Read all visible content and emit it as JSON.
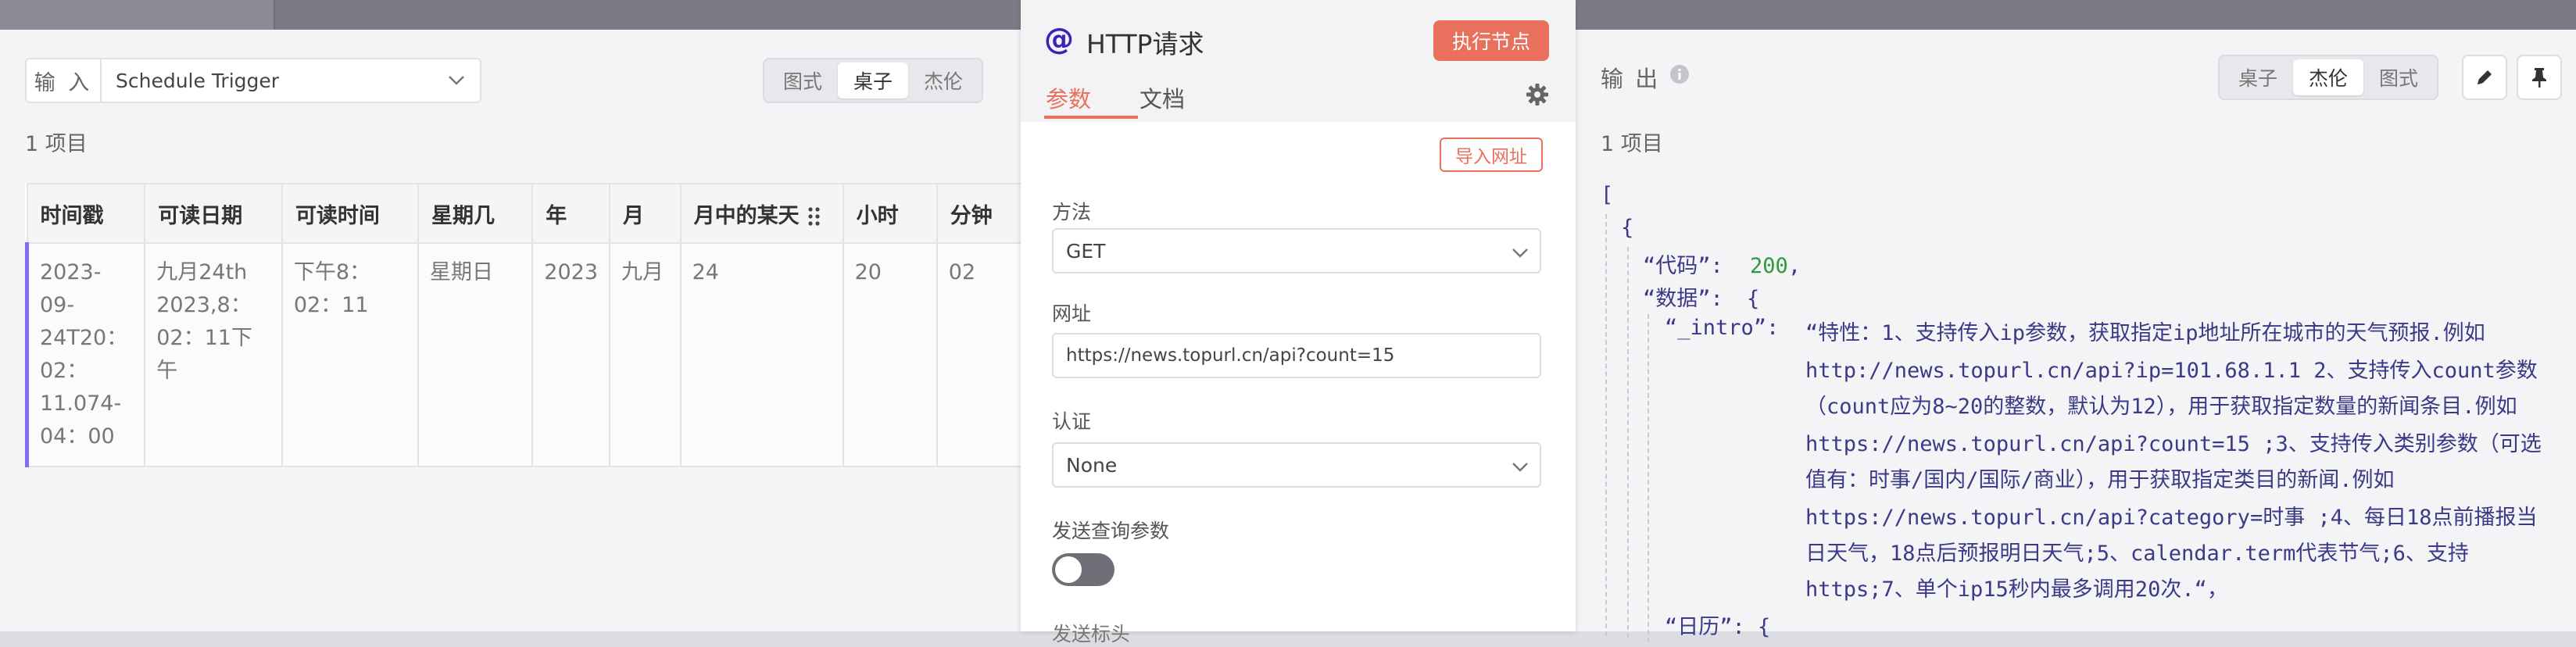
{
  "input": {
    "label": "输 入",
    "selected": "Schedule Trigger",
    "view_options": [
      "图式",
      "桌子",
      "杰伦"
    ],
    "active_view": 1,
    "count": "1 项目"
  },
  "table": {
    "headers": [
      "时间戳",
      "可读日期",
      "可读时间",
      "星期几",
      "年",
      "月",
      "月中的某天",
      "小时",
      "分钟"
    ],
    "row": [
      [
        "2023-09-",
        "24T20：",
        "02：",
        "11.074-",
        "04：00"
      ],
      [
        "九月24th",
        "2023,8：",
        "02：11下午"
      ],
      [
        "下午8：",
        "02：11"
      ],
      [
        "星期日"
      ],
      [
        "2023"
      ],
      [
        "九月"
      ],
      [
        "24"
      ],
      [
        "20"
      ],
      [
        "02"
      ]
    ]
  },
  "modal": {
    "icon": "@",
    "title": "HTTP请求",
    "run_button": "执行节点",
    "tabs": [
      "参数",
      "文档"
    ],
    "active_tab": 0,
    "import_button": "导入网址",
    "method_label": "方法",
    "method_value": "GET",
    "url_label": "网址",
    "url_value": "https://news.topurl.cn/api?count=15",
    "auth_label": "认证",
    "auth_value": "None",
    "query_label": "发送查询参数",
    "query_enabled": false,
    "cut_label": "发送标头"
  },
  "output": {
    "title": "输 出",
    "view_options": [
      "桌子",
      "杰伦",
      "图式"
    ],
    "active_view": 1,
    "count": "1 项目",
    "json": {
      "open_bracket": "[",
      "open_brace": "{",
      "code_key": "“代码”:",
      "code_val": "200",
      "comma": ",",
      "data_key": "“数据”:",
      "data_brace": "{",
      "intro_key": "“_intro”:",
      "intro_lines": [
        "“特性：1、支持传入ip参数，获取指定ip地址所在城市的天气预报.例如",
        "http://news.topurl.cn/api?ip=101.68.1.1 2、支持传入count参数",
        "（count应为8~20的整数，默认为12），用于获取指定数量的新闻条目.例如",
        "https://news.topurl.cn/api?count=15 ;3、支持传入类别参数（可选",
        "值有：时事/国内/国际/商业），用于获取指定类目的新闻.例如",
        "https://news.topurl.cn/api?category=时事 ;4、每日18点前播报当",
        "日天气，18点后预报明日天气;5、calendar.term代表节气;6、支持",
        "https;7、单个ip15秒内最多调用20次.“，"
      ],
      "calendar_key": "“日历”:  {"
    }
  }
}
